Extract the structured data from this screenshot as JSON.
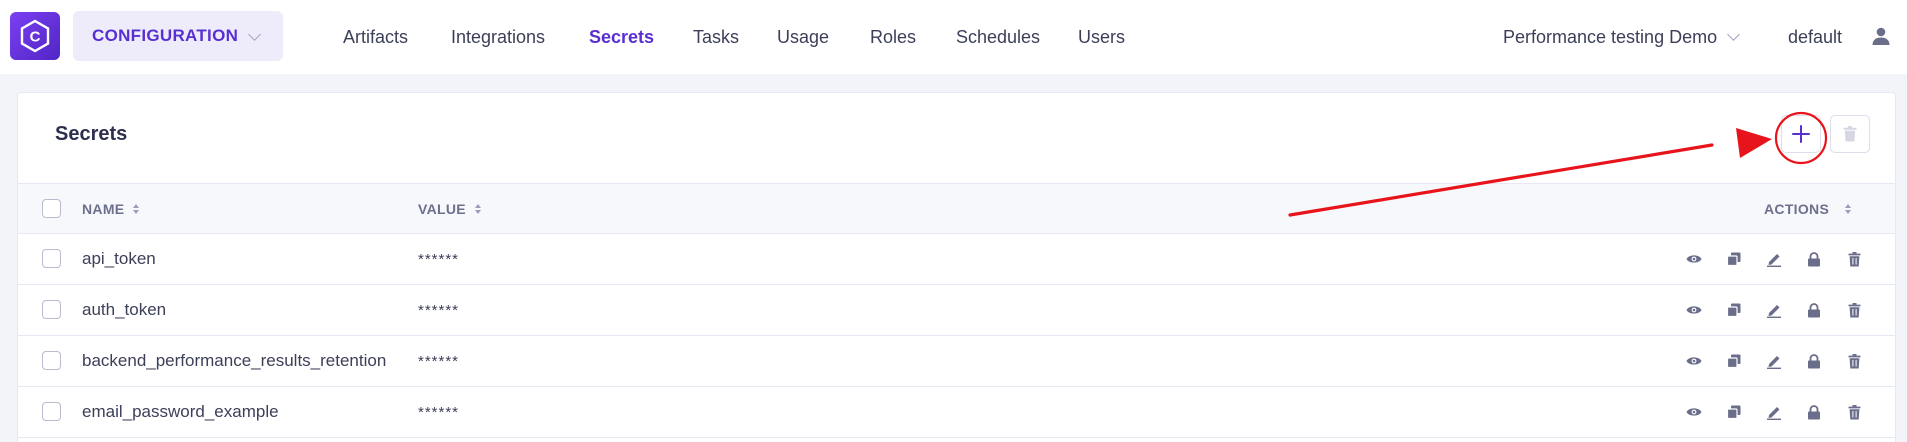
{
  "app": {
    "logo_letter": "C"
  },
  "mode_selector": {
    "label": "CONFIGURATION"
  },
  "nav": [
    {
      "label": "Artifacts",
      "active": false
    },
    {
      "label": "Integrations",
      "active": false
    },
    {
      "label": "Secrets",
      "active": true
    },
    {
      "label": "Tasks",
      "active": false
    },
    {
      "label": "Usage",
      "active": false
    },
    {
      "label": "Roles",
      "active": false
    },
    {
      "label": "Schedules",
      "active": false
    },
    {
      "label": "Users",
      "active": false
    }
  ],
  "project": {
    "label": "Performance testing Demo"
  },
  "tenant": {
    "label": "default"
  },
  "card": {
    "title": "Secrets"
  },
  "table": {
    "columns": {
      "name": "NAME",
      "value": "VALUE",
      "actions": "ACTIONS"
    },
    "rows": [
      {
        "name": "api_token",
        "value": "******"
      },
      {
        "name": "auth_token",
        "value": "******"
      },
      {
        "name": "backend_performance_results_retention",
        "value": "******"
      },
      {
        "name": "email_password_example",
        "value": "******"
      }
    ],
    "row_actions": [
      "eye-icon",
      "copy-icon",
      "edit-icon",
      "lock-icon",
      "trash-icon"
    ]
  },
  "colors": {
    "accent": "#5a2fd1",
    "annotation": "#e8141c",
    "icon": "#6b6e8a"
  }
}
